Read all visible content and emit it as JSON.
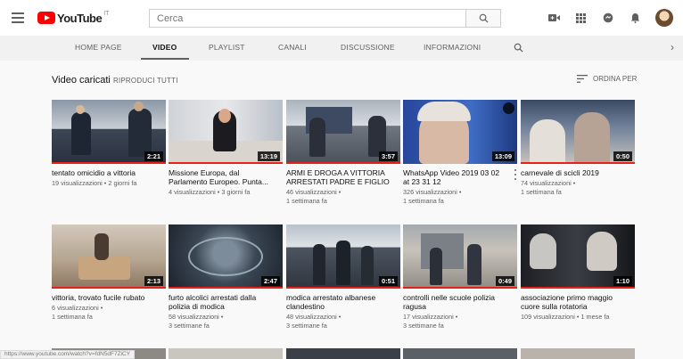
{
  "masthead": {
    "logo_text": "YouTube",
    "logo_cc": "IT",
    "search_placeholder": "Cerca",
    "icons": [
      "menu-icon",
      "search-icon",
      "upload-video-icon",
      "apps-grid-icon",
      "messages-icon",
      "notifications-bell-icon",
      "avatar"
    ]
  },
  "tabs": [
    {
      "label": "HOME PAGE",
      "active": false
    },
    {
      "label": "VIDEO",
      "active": true
    },
    {
      "label": "PLAYLIST",
      "active": false
    },
    {
      "label": "CANALI",
      "active": false
    },
    {
      "label": "DISCUSSIONE",
      "active": false
    },
    {
      "label": "INFORMAZIONI",
      "active": false
    }
  ],
  "section": {
    "title": "Video caricati",
    "play_all": "RIPRODUCI TUTTI",
    "sort_label": "ORDINA PER"
  },
  "videos": [
    {
      "title_line1": "tentato omicidio a vittoria",
      "title_line2": "",
      "meta_line1": "19 visualizzazioni • 2 giorni fa",
      "meta_line2": "",
      "duration": "2:21",
      "watched": true
    },
    {
      "title_line1": "Missione Europa, dal",
      "title_line2": "Parlamento Europeo. Punta...",
      "meta_line1": "4 visualizzazioni • 3 giorni fa",
      "meta_line2": "",
      "duration": "13:19",
      "watched": true
    },
    {
      "title_line1": "ARMI E DROGA A VITTORIA",
      "title_line2": "ARRESTATI PADRE E FIGLIO",
      "meta_line1": "46 visualizzazioni •",
      "meta_line2": "1 settimana fa",
      "duration": "3:57",
      "watched": true
    },
    {
      "title_line1": "WhatsApp Video 2019 03 02",
      "title_line2": "at 23 31 12",
      "meta_line1": "326 visualizzazioni •",
      "meta_line2": "1 settimana fa",
      "duration": "13:09",
      "watched": false
    },
    {
      "title_line1": "carnevale di scicli 2019",
      "title_line2": "",
      "meta_line1": "74 visualizzazioni •",
      "meta_line2": "1 settimana fa",
      "duration": "0:50",
      "watched": true
    },
    {
      "title_line1": "vittoria, trovato fucile rubato",
      "title_line2": "",
      "meta_line1": "6 visualizzazioni •",
      "meta_line2": "1 settimana fa",
      "duration": "2:13",
      "watched": true
    },
    {
      "title_line1": "furto alcolici arrestati dalla",
      "title_line2": "polizia di modica",
      "meta_line1": "58 visualizzazioni •",
      "meta_line2": "3 settimane fa",
      "duration": "2:47",
      "watched": true
    },
    {
      "title_line1": "modica arrestato albanese",
      "title_line2": "clandestino",
      "meta_line1": "48 visualizzazioni •",
      "meta_line2": "3 settimane fa",
      "duration": "0:51",
      "watched": true
    },
    {
      "title_line1": "controlli nelle scuole polizia",
      "title_line2": "ragusa",
      "meta_line1": "17 visualizzazioni •",
      "meta_line2": "3 settimane fa",
      "duration": "0:49",
      "watched": true
    },
    {
      "title_line1": "associazione primo maggio",
      "title_line2": "cuore sulla rotatoria",
      "meta_line1": "109 visualizzazioni • 1 mese fa",
      "meta_line2": "",
      "duration": "1:10",
      "watched": true
    }
  ],
  "status_url": "https://www.youtube.com/watch?v=fdN5dF7ZiCY",
  "colors": {
    "brand_red": "#ff0000",
    "watched_bar": "#e62117",
    "tab_bg": "#f1f1f1",
    "page_bg": "#f9f9f9"
  }
}
